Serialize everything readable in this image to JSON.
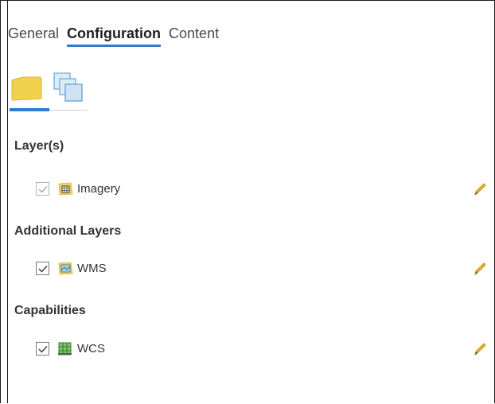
{
  "tabs": [
    {
      "label": "General"
    },
    {
      "label": "Configuration"
    },
    {
      "label": "Content"
    }
  ],
  "sections": {
    "layers": {
      "title": "Layer(s)",
      "item": {
        "label": "Imagery",
        "checked": true,
        "disabled": true
      }
    },
    "additional": {
      "title": "Additional Layers",
      "item": {
        "label": "WMS",
        "checked": true
      }
    },
    "capabilities": {
      "title": "Capabilities",
      "item": {
        "label": "WCS",
        "checked": true
      }
    }
  },
  "colors": {
    "accent": "#2b7cd3",
    "folder": "#f2d24d"
  },
  "icons": [
    "folder-tab-icon",
    "layers-tab-icon",
    "raster-icon",
    "wms-map-icon",
    "wcs-grid-icon",
    "pencil-edit-icon"
  ]
}
